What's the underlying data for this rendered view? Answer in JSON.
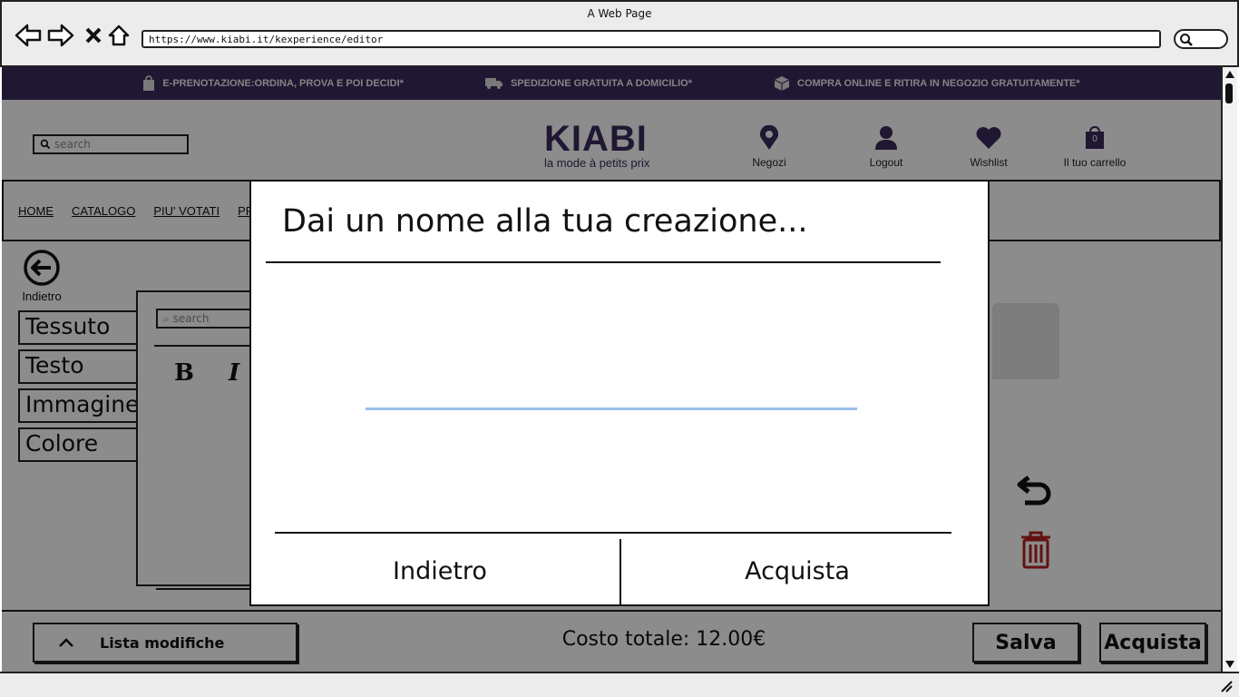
{
  "browser": {
    "window_title": "A Web Page",
    "url": "https://www.kiabi.it/kexperience/editor"
  },
  "promo": {
    "items": [
      {
        "icon": "bag-icon",
        "text": "E-PRENOTAZIONE:ORDINA, PROVA E POI DECIDI*"
      },
      {
        "icon": "truck-icon",
        "text": "SPEDIZIONE GRATUITA A DOMICILIO*"
      },
      {
        "icon": "box-icon",
        "text": "COMPRA ONLINE E RITIRA IN NEGOZIO GRATUITAMENTE*"
      }
    ]
  },
  "header": {
    "search_placeholder": "search",
    "logo": "KIABI",
    "logo_tagline": "la mode à petits prix",
    "links": [
      {
        "icon": "map-pin-icon",
        "label": "Negozi"
      },
      {
        "icon": "user-icon",
        "label": "Logout"
      },
      {
        "icon": "heart-icon",
        "label": "Wishlist"
      },
      {
        "icon": "cart-icon",
        "label": "Il tuo carrello",
        "badge": "0"
      }
    ]
  },
  "menu": {
    "items": [
      "HOME",
      "CATALOGO",
      "PIU' VOTATI",
      "PR"
    ]
  },
  "editor": {
    "back_label": "Indietro",
    "tabs": [
      "Tessuto",
      "Testo",
      "Immagine",
      "Colore"
    ],
    "panel_search_placeholder": "search",
    "bold": "B",
    "italic": "I"
  },
  "bottom": {
    "lista_label": "Lista modifiche",
    "costo": "Costo totale: 12.00€",
    "salva": "Salva",
    "acquista": "Acquista"
  },
  "modal": {
    "title": "Dai un nome alla tua creazione...",
    "input_value": "",
    "back_button": "Indietro",
    "buy_button": "Acquista"
  },
  "colors": {
    "brand": "#3b2b5c",
    "input_underline": "#9ec0ee",
    "trash": "#b22222"
  }
}
